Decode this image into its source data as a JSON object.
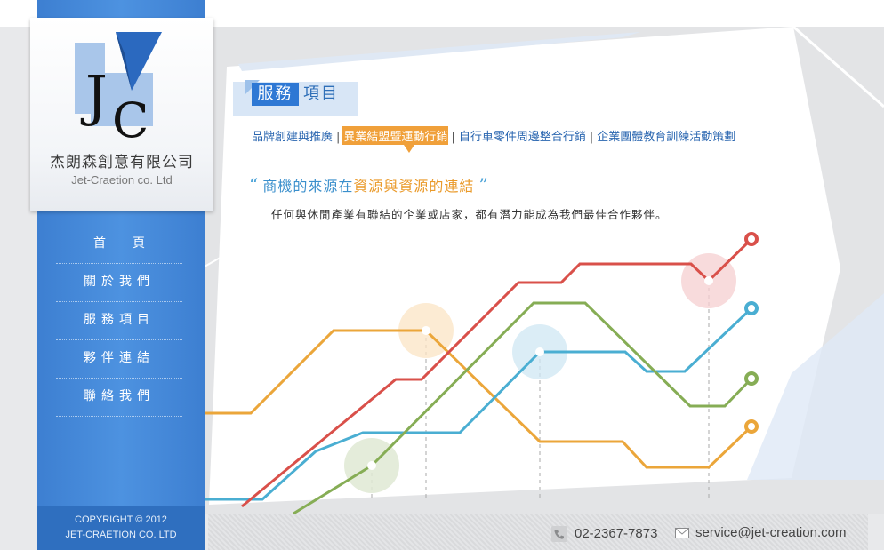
{
  "company": {
    "logo_letters": "JC",
    "name_cn": "杰朗森創意有限公司",
    "name_en": "Jet-Craetion co. Ltd"
  },
  "nav": {
    "items": [
      {
        "label": "首頁"
      },
      {
        "label": "關於我們"
      },
      {
        "label": "服務項目"
      },
      {
        "label": "夥伴連結"
      },
      {
        "label": "聯絡我們"
      }
    ]
  },
  "copyright": {
    "line1": "COPYRIGHT © 2012",
    "line2": "JET-CRAETION CO. LTD"
  },
  "section": {
    "label_highlight": "服務",
    "label_rest": "項目"
  },
  "tabs": [
    {
      "label": "品牌創建與推廣",
      "active": false
    },
    {
      "label": "異業結盟暨運動行銷",
      "active": true
    },
    {
      "label": "自行車零件周邊整合行銷",
      "active": false
    },
    {
      "label": "企業團體教育訓練活動策劃",
      "active": false
    }
  ],
  "tab_separator": "|",
  "quote": {
    "open_mark": "“",
    "part1": "商機的來源在",
    "part2": "資源與資源的連結",
    "close_mark": "”",
    "body": "任何與休閒產業有聯結的企業或店家，都有潛力能成為我們最佳合作夥伴。"
  },
  "footer": {
    "phone": "02-2367-7873",
    "email": "service@jet-creation.com"
  },
  "colors": {
    "sidebar_blue": "#3d7fd1",
    "accent_orange": "#f0a03a",
    "line_red": "#d9504a",
    "line_green": "#86ad55",
    "line_blue": "#4aaed2",
    "line_orange": "#eba63a"
  },
  "icons": {
    "phone": "phone-icon",
    "mail": "mail-icon"
  }
}
